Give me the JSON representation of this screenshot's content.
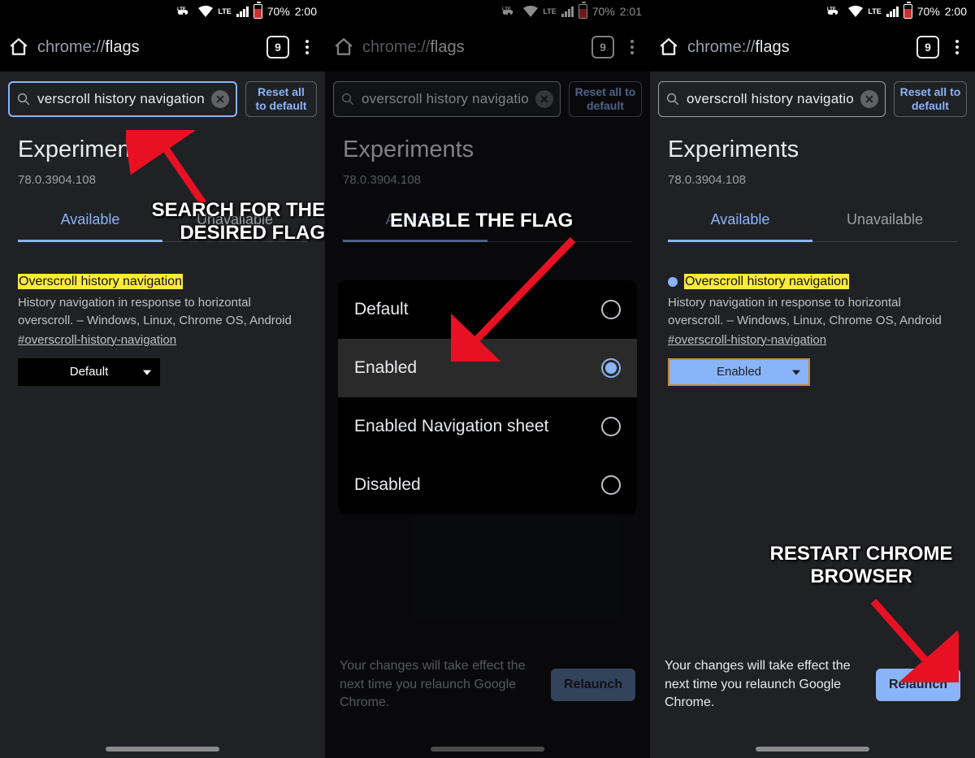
{
  "status": {
    "battery": "70%",
    "time1": "2:00",
    "time2": "2:01",
    "time3": "2:00",
    "net": "LTE"
  },
  "toolbar": {
    "url_prefix": "chrome://",
    "url_suffix": "flags",
    "tab_count": "9"
  },
  "search": {
    "value1": "verscroll history navigation",
    "value2": "overscroll history navigatio",
    "value3": "overscroll history navigatio",
    "reset_label": "Reset all to default"
  },
  "page": {
    "title": "Experiments",
    "version": "78.0.3904.108",
    "tab_available": "Available",
    "tab_unavailable": "Unavailable"
  },
  "flag": {
    "title": "Overscroll history navigation",
    "desc": "History navigation in response to horizontal overscroll. – Windows, Linux, Chrome OS, Android",
    "hash": "#overscroll-history-navigation",
    "dropdown_default": "Default",
    "dropdown_enabled": "Enabled"
  },
  "sheet": {
    "opt1": "Default",
    "opt2": "Enabled",
    "opt3": "Enabled Navigation sheet",
    "opt4": "Disabled"
  },
  "relaunch": {
    "msg": "Your changes will take effect the next time you relaunch Google Chrome.",
    "btn": "Relaunch"
  },
  "anno": {
    "a1": "SEARCH FOR THE DESIRED FLAG",
    "a2": "ENABLE THE FLAG",
    "a3": "RESTART CHROME BROWSER"
  }
}
